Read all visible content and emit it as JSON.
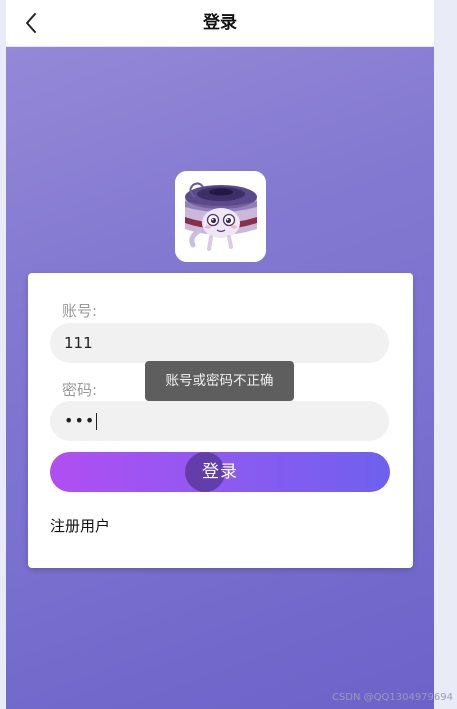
{
  "navbar": {
    "title": "登录",
    "back_icon": "chevron-left-icon"
  },
  "logo": {
    "icon": "mascot-avatar"
  },
  "form": {
    "account_label": "账号:",
    "account_value": "111",
    "password_label": "密码:",
    "password_value": "•••",
    "login_label": "登录",
    "register_label": "注册用户"
  },
  "toast": {
    "message": "账号或密码不正确"
  },
  "watermark": "CSDN @QQ1304979694",
  "colors": {
    "background_top": "#978bd8",
    "background_bottom": "#6c62c9",
    "button_start": "#b14ef2",
    "button_end": "#6f60ee",
    "toast_bg": "#555555"
  }
}
